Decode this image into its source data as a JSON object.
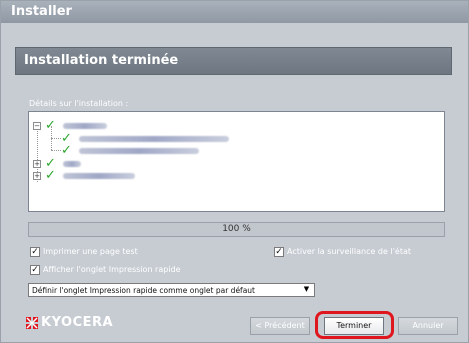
{
  "window": {
    "title": "Installer"
  },
  "header": {
    "title": "Installation terminée"
  },
  "details": {
    "label": "Détails sur l'installation :",
    "tree_icons": [
      "expander-minus-icon",
      "check-icon",
      "expander-plus-icon"
    ]
  },
  "progress": {
    "value": 100,
    "text": "100 %"
  },
  "options": {
    "print_test_page": {
      "label": "Imprimer une page test",
      "checked": true
    },
    "activate_monitoring": {
      "label": "Activer la surveillance de l'état",
      "checked": true
    },
    "show_quick_print_tab": {
      "label": "Afficher l'onglet Impression rapide",
      "checked": true
    }
  },
  "dropdown": {
    "selected": "Définir l'onglet Impression rapide comme onglet par défaut"
  },
  "logo": {
    "text": "KYOCERA",
    "mark_color": "#e0161e"
  },
  "buttons": {
    "previous": "< Précédent",
    "finish": "Terminer",
    "cancel": "Annuler"
  },
  "colors": {
    "highlight": "#e0161e",
    "check": "#2aa62a"
  }
}
